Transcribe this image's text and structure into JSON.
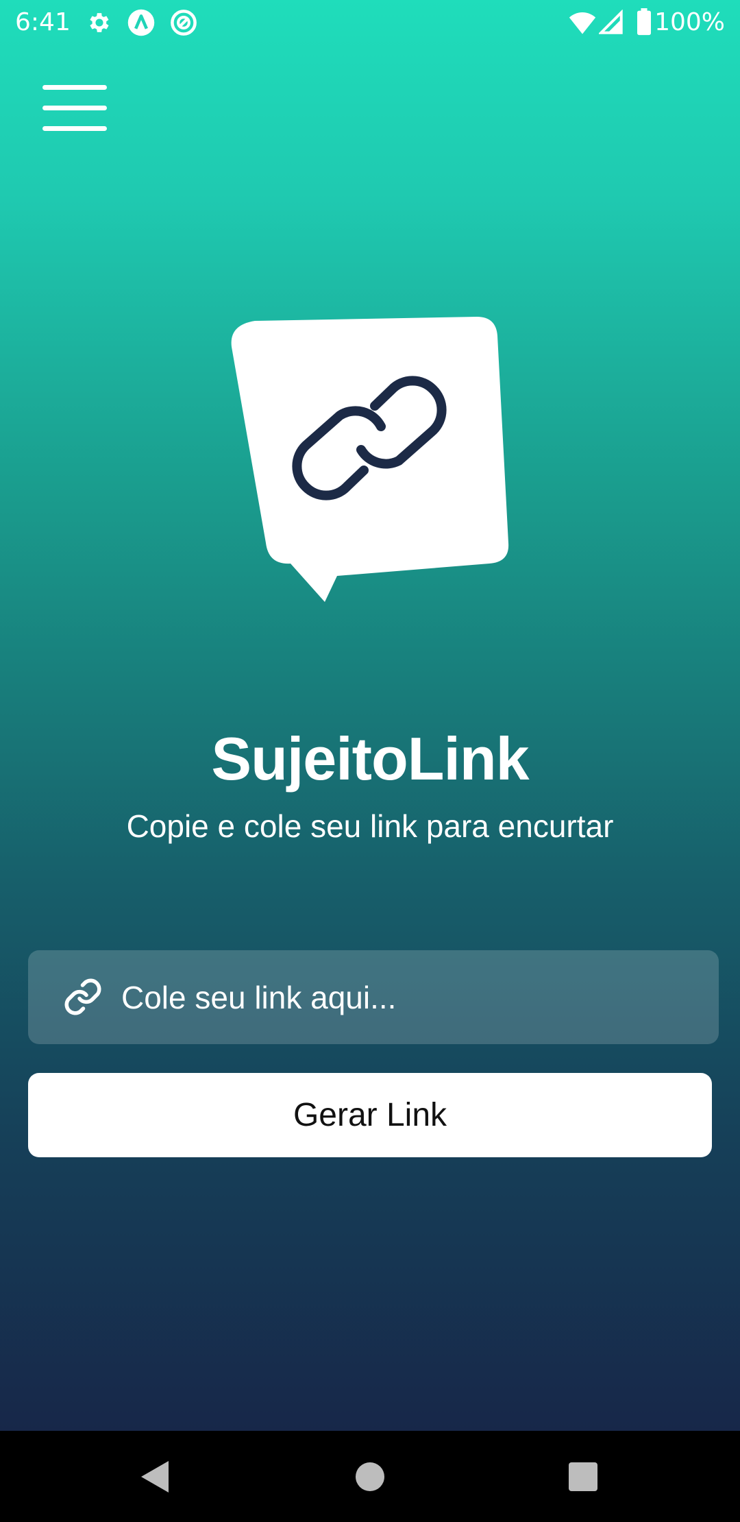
{
  "status_bar": {
    "time": "6:41",
    "battery": "100%",
    "icons": [
      "gear-icon",
      "a-circle-icon",
      "sync-circle-icon",
      "wifi-icon",
      "cell-signal-icon",
      "battery-icon"
    ]
  },
  "header": {
    "menu_icon": "hamburger-menu-icon"
  },
  "hero": {
    "logo_icon": "chat-bubble-link-icon",
    "title": "SujeitoLink",
    "subtitle": "Copie e cole seu link para encurtar"
  },
  "form": {
    "input_icon": "link-icon",
    "input_value": "",
    "input_placeholder": "Cole seu link aqui...",
    "button_label": "Gerar Link"
  },
  "nav_bar": {
    "icons": [
      "back-icon",
      "home-icon",
      "recents-icon"
    ]
  },
  "colors": {
    "gradient_top": "#1fddbb",
    "gradient_bottom": "#172749",
    "logo_ink": "#1c2a46",
    "button_bg": "#ffffff"
  }
}
